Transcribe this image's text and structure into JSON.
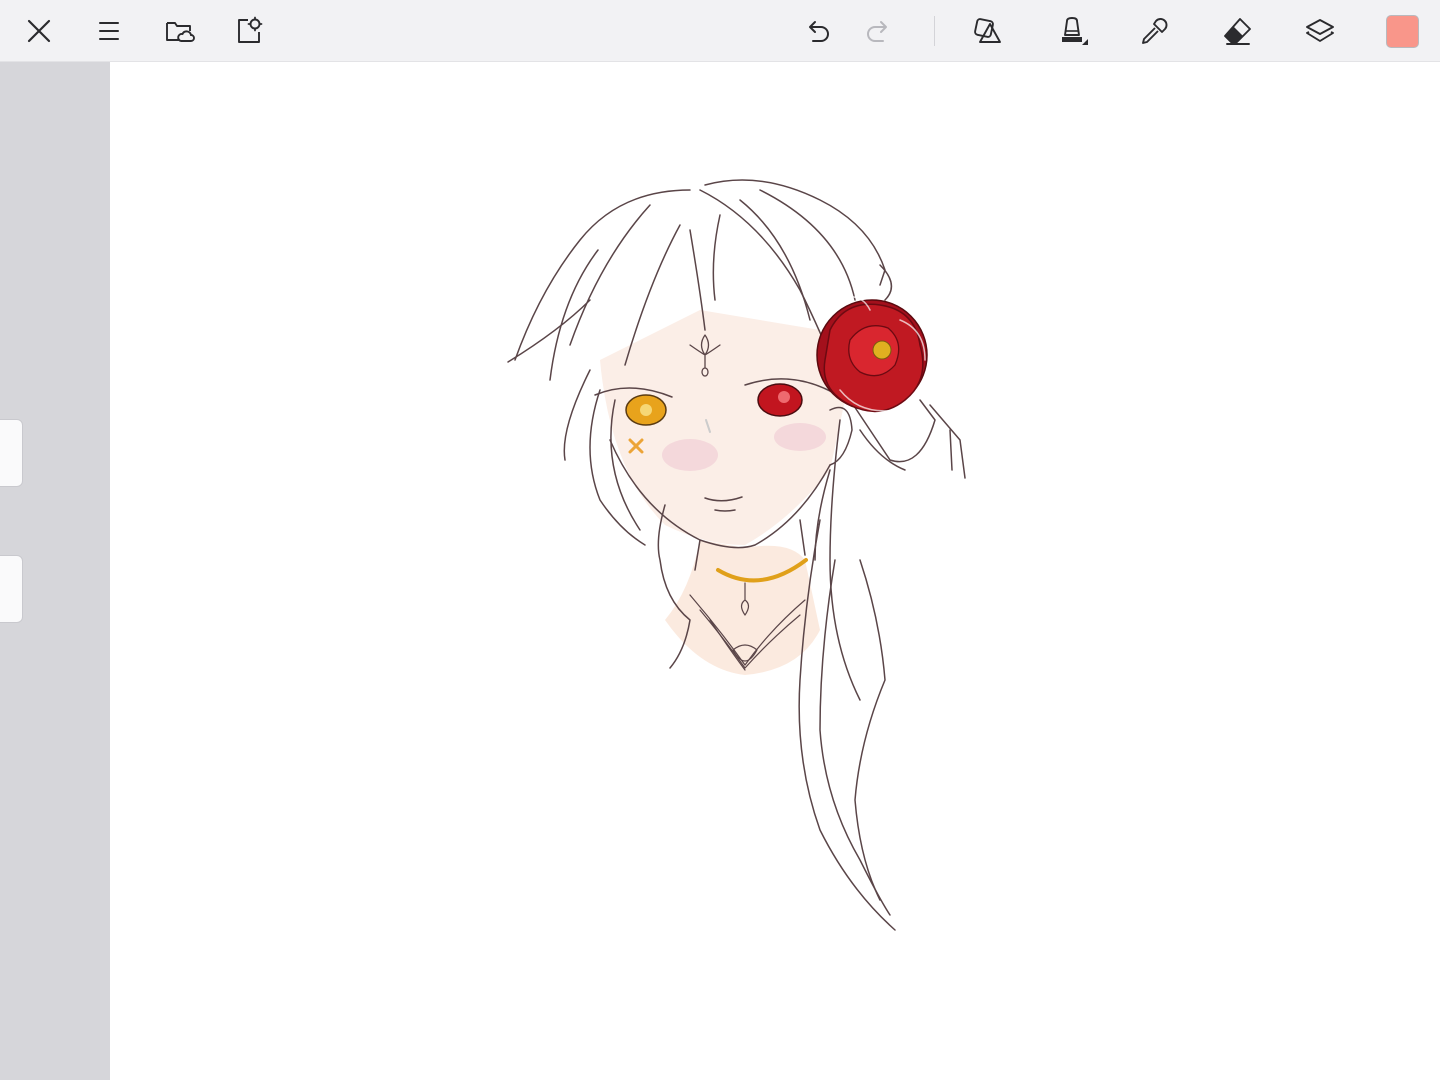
{
  "app": {
    "name": "Drawing canvas"
  },
  "toolbar": {
    "left": [
      {
        "name": "close",
        "icon": "close-icon"
      },
      {
        "name": "menu",
        "icon": "menu-icon"
      },
      {
        "name": "gallery",
        "icon": "folder-cloud-icon"
      },
      {
        "name": "canvas-settings",
        "icon": "document-gear-icon"
      }
    ],
    "right": [
      {
        "name": "undo",
        "icon": "undo-icon",
        "enabled": true
      },
      {
        "name": "redo",
        "icon": "redo-icon",
        "enabled": false
      },
      {
        "name": "shapes",
        "icon": "shapes-icon"
      },
      {
        "name": "brush",
        "icon": "brush-icon"
      },
      {
        "name": "eyedropper",
        "icon": "eyedropper-icon"
      },
      {
        "name": "eraser",
        "icon": "eraser-icon"
      },
      {
        "name": "layers",
        "icon": "layers-icon"
      }
    ],
    "current_color": "#f9968a"
  },
  "sidebar": {
    "sliders": [
      {
        "name": "brush-size",
        "icon": "slider-handle"
      },
      {
        "name": "brush-opacity",
        "icon": "slider-handle"
      }
    ]
  },
  "canvas": {
    "background": "#ffffff",
    "artwork": {
      "description_icon": "sketch-portrait-icon",
      "line_color": "#5a4548",
      "accent_flower": "#b5151f",
      "eye_left": "#e8a31c",
      "eye_right": "#c2151f",
      "necklace": "#e0a01a",
      "skin": "#fbe9e0"
    }
  }
}
